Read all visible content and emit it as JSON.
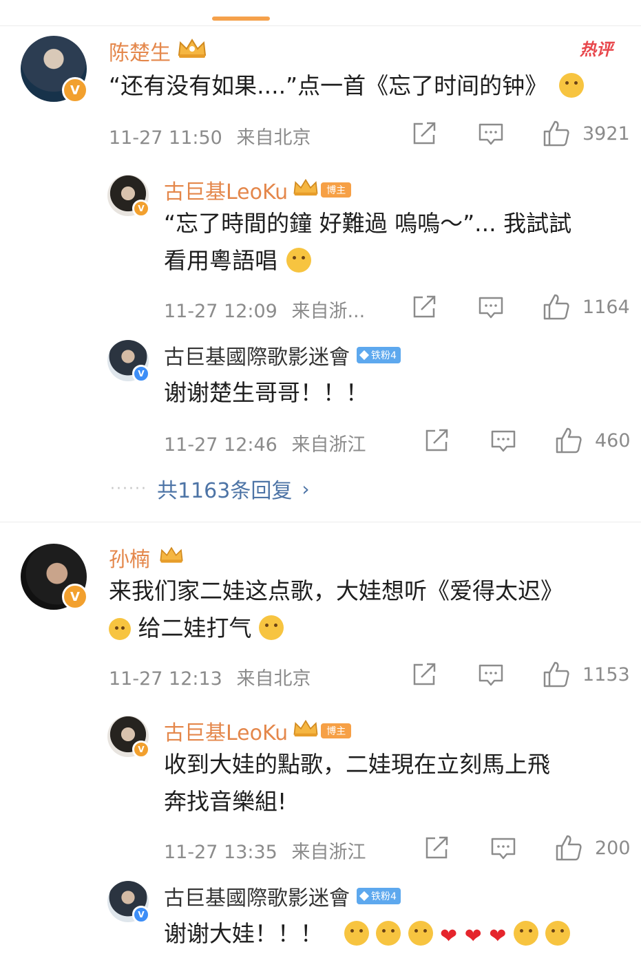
{
  "colors": {
    "accent": "#f5a14b",
    "vip_name": "#e4874b",
    "link": "#4d74a6",
    "meta": "#8b8b8b",
    "hot": "#e8474c",
    "badge_blue": "#3d8ef7"
  },
  "hot_tag": "热评",
  "comment1": {
    "name": "陈楚生",
    "text": "“还有没有如果....”点一首《忘了时间的钟》",
    "time": "11-27 11:50",
    "location": "来自北京",
    "likes": "3921",
    "replies": [
      {
        "name": "古巨基LeoKu",
        "badge": "博主",
        "line1": "“忘了時間的鐘 好難過 嗚嗚～”... 我試試",
        "line2": "看用粵語唱",
        "time": "11-27 12:09",
        "location": "来自浙...",
        "likes": "1164"
      },
      {
        "name": "古巨基國際歌影迷會",
        "badge": "铁粉4",
        "text": "谢谢楚生哥哥！！！",
        "time": "11-27 12:46",
        "location": "来自浙江",
        "likes": "460"
      }
    ],
    "more": "共1163条回复"
  },
  "comment2": {
    "name": "孙楠",
    "line1": "来我们家二娃这点歌，大娃想听《爱得太迟》",
    "line2": "给二娃打气",
    "time": "11-27 12:13",
    "location": "来自北京",
    "likes": "1153",
    "replies": [
      {
        "name": "古巨基LeoKu",
        "badge": "博主",
        "line1": "收到大娃的點歌，二娃現在立刻馬上飛",
        "line2": "奔找音樂組!",
        "time": "11-27 13:35",
        "location": "来自浙江",
        "likes": "200"
      },
      {
        "name": "古巨基國際歌影迷會",
        "badge": "铁粉4",
        "text": "谢谢大娃！！！"
      }
    ]
  },
  "icons": {
    "verified_badge": "V",
    "heart": "❤",
    "chevron": "›",
    "dots": "······"
  }
}
